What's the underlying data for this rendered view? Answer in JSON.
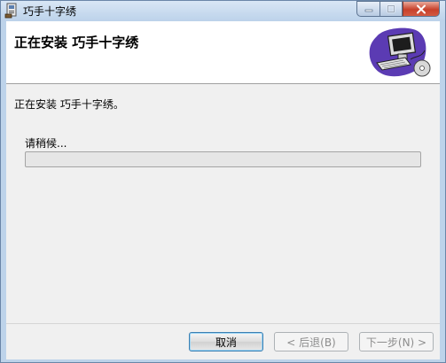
{
  "window": {
    "title": "巧手十字绣",
    "app_icon": "installer-package-icon",
    "controls": {
      "minimize_icon": "minimize-icon",
      "maximize_icon": "maximize-icon",
      "close_icon": "close-icon"
    }
  },
  "header": {
    "title": "正在安装 巧手十字绣",
    "graphic": "computer-setup-icon"
  },
  "content": {
    "status_text": "正在安装 巧手十字绣。",
    "wait_text": "请稍候...",
    "progress": 0
  },
  "footer": {
    "cancel_label": "取消",
    "back_label": "< 后退(B)",
    "next_label": "下一步(N) >"
  },
  "colors": {
    "frame": "#bdd3ea",
    "panel": "#f0f0f0",
    "close_button": "#c7412b",
    "default_button_border": "#3c7fb1"
  }
}
